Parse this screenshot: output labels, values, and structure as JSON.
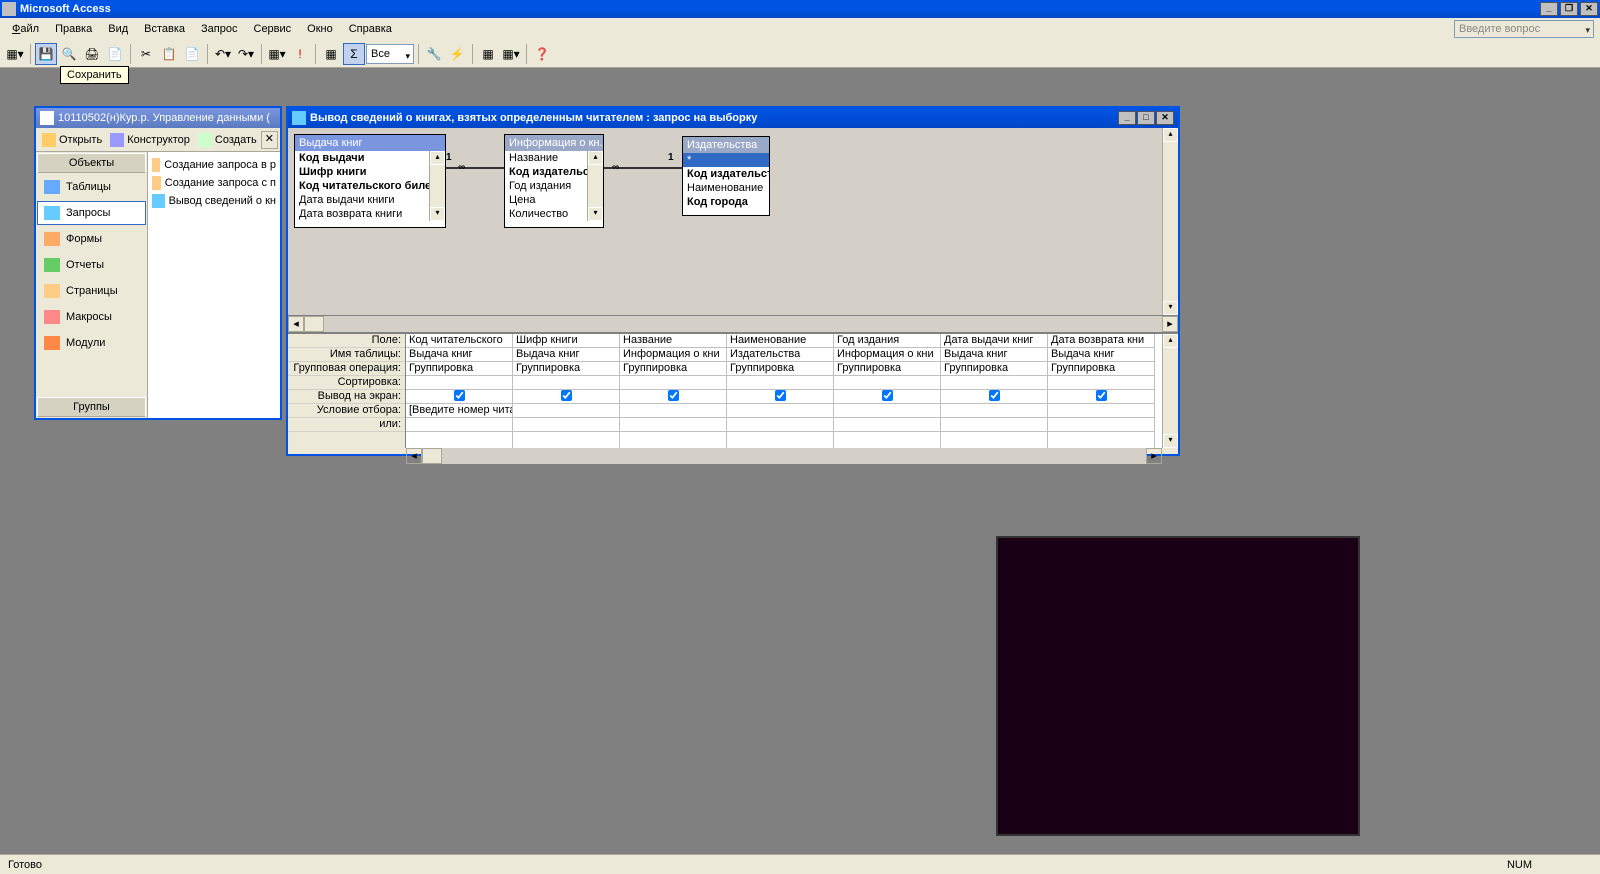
{
  "app": {
    "title": "Microsoft Access"
  },
  "menubar": {
    "file": "Файл",
    "edit": "Правка",
    "view": "Вид",
    "insert": "Вставка",
    "query": "Запрос",
    "service": "Сервис",
    "window": "Окно",
    "help": "Справка",
    "question_placeholder": "Введите вопрос"
  },
  "toolbar": {
    "tooltip_save": "Сохранить",
    "combo_value": "Все"
  },
  "dbwin": {
    "title": "10110502(н)Кур.р. Управление данными (",
    "tb_open": "Открыть",
    "tb_design": "Конструктор",
    "tb_new": "Создать",
    "nav_objects": "Объекты",
    "nav_groups": "Группы",
    "nav_tables": "Таблицы",
    "nav_queries": "Запросы",
    "nav_forms": "Формы",
    "nav_reports": "Отчеты",
    "nav_pages": "Страницы",
    "nav_macros": "Макросы",
    "nav_modules": "Модули",
    "item_createdesign": "Создание запроса в р",
    "item_createwizard": "Создание запроса с п",
    "item_query1": "Вывод сведений о кн"
  },
  "qwin": {
    "title": "Вывод сведений о книгах, взятых определенным читателем : запрос на выборку"
  },
  "tables": {
    "t1": {
      "name": "Выдача книг",
      "fields": [
        "Код выдачи",
        "Шифр книги",
        "Код читательского билета",
        "Дата выдачи книги",
        "Дата возврата книги"
      ]
    },
    "t2": {
      "name": "Информация о кн...",
      "fields": [
        "Название",
        "Код издательства",
        "Год издания",
        "Цена",
        "Количество"
      ]
    },
    "t3": {
      "name": "Издательства",
      "fields": [
        "*",
        "Код издательст",
        "Наименование",
        "Код города"
      ]
    }
  },
  "rel": {
    "one": "1",
    "many": "∞"
  },
  "grid": {
    "labels": {
      "field": "Поле:",
      "table": "Имя таблицы:",
      "groupop": "Групповая операция:",
      "sort": "Сортировка:",
      "show": "Вывод на экран:",
      "criteria": "Условие отбора:",
      "or": "или:"
    },
    "cols": [
      {
        "field": "Код читательского",
        "table": "Выдача книг",
        "op": "Группировка",
        "show": true,
        "crit": "[Введите номер читат"
      },
      {
        "field": "Шифр книги",
        "table": "Выдача книг",
        "op": "Группировка",
        "show": true,
        "crit": ""
      },
      {
        "field": "Название",
        "table": "Информация о кни",
        "op": "Группировка",
        "show": true,
        "crit": ""
      },
      {
        "field": "Наименование",
        "table": "Издательства",
        "op": "Группировка",
        "show": true,
        "crit": ""
      },
      {
        "field": "Год издания",
        "table": "Информация о кни",
        "op": "Группировка",
        "show": true,
        "crit": ""
      },
      {
        "field": "Дата выдачи книг",
        "table": "Выдача книг",
        "op": "Группировка",
        "show": true,
        "crit": ""
      },
      {
        "field": "Дата возврата кни",
        "table": "Выдача книг",
        "op": "Группировка",
        "show": true,
        "crit": ""
      }
    ]
  },
  "status": {
    "ready": "Готово",
    "num": "NUM"
  }
}
